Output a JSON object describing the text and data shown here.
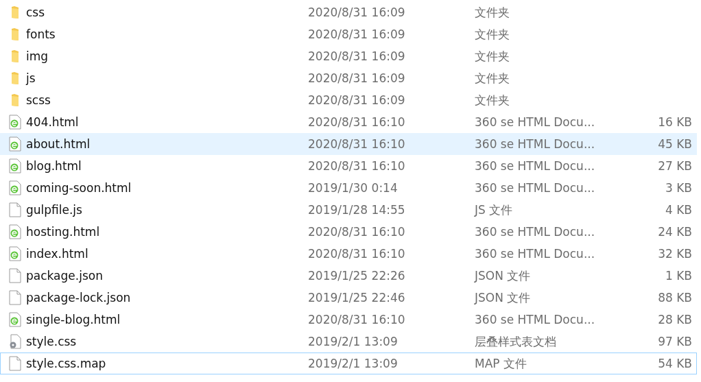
{
  "files": [
    {
      "name": "css",
      "date": "2020/8/31 16:09",
      "type": "文件夹",
      "kind": "folder",
      "selected": false,
      "focused": false
    },
    {
      "name": "fonts",
      "date": "2020/8/31 16:09",
      "type": "文件夹",
      "kind": "folder",
      "selected": false,
      "focused": false
    },
    {
      "name": "img",
      "date": "2020/8/31 16:09",
      "type": "文件夹",
      "kind": "folder",
      "selected": false,
      "focused": false
    },
    {
      "name": "js",
      "date": "2020/8/31 16:09",
      "type": "文件夹",
      "kind": "folder",
      "selected": false,
      "focused": false
    },
    {
      "name": "scss",
      "date": "2020/8/31 16:09",
      "type": "文件夹",
      "kind": "folder",
      "selected": false,
      "focused": false
    },
    {
      "name": "404.html",
      "date": "2020/8/31 16:10",
      "type": "360 se HTML Docu...",
      "size": "16 KB",
      "kind": "html",
      "selected": false,
      "focused": false
    },
    {
      "name": "about.html",
      "date": "2020/8/31 16:10",
      "type": "360 se HTML Docu...",
      "size": "45 KB",
      "kind": "html",
      "selected": true,
      "focused": false
    },
    {
      "name": "blog.html",
      "date": "2020/8/31 16:10",
      "type": "360 se HTML Docu...",
      "size": "27 KB",
      "kind": "html",
      "selected": false,
      "focused": false
    },
    {
      "name": "coming-soon.html",
      "date": "2019/1/30 0:14",
      "type": "360 se HTML Docu...",
      "size": "3 KB",
      "kind": "html",
      "selected": false,
      "focused": false
    },
    {
      "name": "gulpfile.js",
      "date": "2019/1/28 14:55",
      "type": "JS 文件",
      "size": "4 KB",
      "kind": "file",
      "selected": false,
      "focused": false
    },
    {
      "name": "hosting.html",
      "date": "2020/8/31 16:10",
      "type": "360 se HTML Docu...",
      "size": "24 KB",
      "kind": "html",
      "selected": false,
      "focused": false
    },
    {
      "name": "index.html",
      "date": "2020/8/31 16:10",
      "type": "360 se HTML Docu...",
      "size": "32 KB",
      "kind": "html",
      "selected": false,
      "focused": false
    },
    {
      "name": "package.json",
      "date": "2019/1/25 22:26",
      "type": "JSON 文件",
      "size": "1 KB",
      "kind": "file",
      "selected": false,
      "focused": false
    },
    {
      "name": "package-lock.json",
      "date": "2019/1/25 22:46",
      "type": "JSON 文件",
      "size": "88 KB",
      "kind": "file",
      "selected": false,
      "focused": false
    },
    {
      "name": "single-blog.html",
      "date": "2020/8/31 16:10",
      "type": "360 se HTML Docu...",
      "size": "28 KB",
      "kind": "html",
      "selected": false,
      "focused": false
    },
    {
      "name": "style.css",
      "date": "2019/2/1 13:09",
      "type": "层叠样式表文档",
      "size": "97 KB",
      "kind": "css",
      "selected": false,
      "focused": false
    },
    {
      "name": "style.css.map",
      "date": "2019/2/1 13:09",
      "type": "MAP 文件",
      "size": "54 KB",
      "kind": "file",
      "selected": false,
      "focused": true
    }
  ]
}
